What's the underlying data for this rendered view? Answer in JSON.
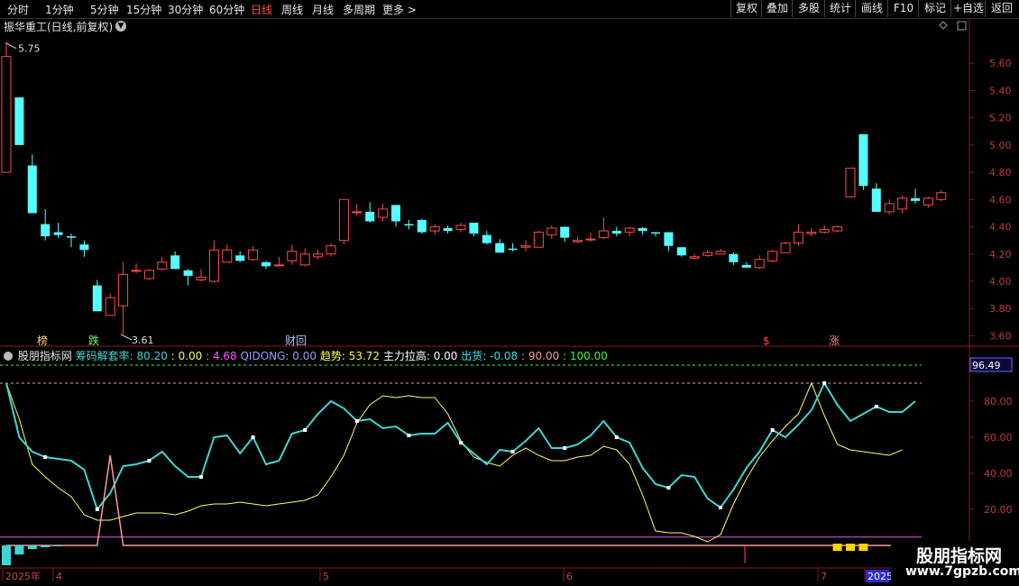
{
  "topbar": {
    "periods": [
      "分时",
      "1分钟",
      "5分钟",
      "15分钟",
      "30分钟",
      "60分钟",
      "日线",
      "周线",
      "月线",
      "多周期",
      "更多 >"
    ],
    "active_period": "日线",
    "buttons": [
      "复权",
      "叠加",
      "多股",
      "统计",
      "画线",
      "F10",
      "标记",
      "+自选",
      "返回"
    ]
  },
  "stock": {
    "title": "振华重工(日线,前复权)",
    "high_label": "5.75",
    "low_label": "3.61"
  },
  "price_axis": [
    "5.60",
    "5.40",
    "5.20",
    "5.00",
    "4.80",
    "4.60",
    "4.40",
    "4.20",
    "4.00",
    "3.80",
    "3.60"
  ],
  "event_markers": [
    {
      "text": "榜",
      "color": "#ffcc66"
    },
    {
      "text": "跌",
      "color": "#66ff66"
    },
    {
      "text": "财|回",
      "color": "#9fc3ff"
    },
    {
      "text": "$",
      "color": "#ff4444"
    },
    {
      "text": "涨",
      "color": "#ff7777"
    }
  ],
  "indicator": {
    "name": "股朋指标网",
    "items": [
      {
        "text": "筹码解套率: 80.20",
        "color": "#3fd6d6"
      },
      {
        "text": " : 0.00",
        "color": "#ffff66"
      },
      {
        "text": " : 4.68",
        "color": "#ff55ff"
      },
      {
        "text": " QIDONG: 0.00",
        "color": "#9a9aff"
      },
      {
        "text": " 趋势: 53.72",
        "color": "#ffff33"
      },
      {
        "text": " 主力拉高: 0.00",
        "color": "#ffffff"
      },
      {
        "text": " 出货: -0.08",
        "color": "#33e5e5"
      },
      {
        "text": " : 90.00",
        "color": "#ff9a9a"
      },
      {
        "text": " : 100.00",
        "color": "#33ff33"
      }
    ],
    "axis": [
      "80.00",
      "60.00",
      "40.00",
      "20.00"
    ],
    "current_value": "96.49"
  },
  "date_axis": [
    "2025年",
    "4",
    "5",
    "6",
    "7",
    "2025"
  ],
  "watermark": {
    "cn": "股朋指标网",
    "url": "www.7gpzb.com"
  },
  "chart_data": {
    "type": "candlestick",
    "title": "振华重工(日线,前复权)",
    "ylim": [
      3.55,
      5.8
    ],
    "candles": [
      {
        "o": 4.8,
        "c": 5.65,
        "h": 5.75,
        "l": 4.8
      },
      {
        "o": 5.35,
        "c": 5.0,
        "h": 5.35,
        "l": 5.0
      },
      {
        "o": 4.85,
        "c": 4.5,
        "h": 4.93,
        "l": 4.5
      },
      {
        "o": 4.42,
        "c": 4.33,
        "h": 4.53,
        "l": 4.3
      },
      {
        "o": 4.36,
        "c": 4.34,
        "h": 4.43,
        "l": 4.32
      },
      {
        "o": 4.33,
        "c": 4.32,
        "h": 4.35,
        "l": 4.25
      },
      {
        "o": 4.27,
        "c": 4.23,
        "h": 4.3,
        "l": 4.18
      },
      {
        "o": 3.97,
        "c": 3.78,
        "h": 4.01,
        "l": 3.78
      },
      {
        "o": 3.75,
        "c": 3.88,
        "h": 3.91,
        "l": 3.75
      },
      {
        "o": 3.82,
        "c": 4.05,
        "h": 4.14,
        "l": 3.61
      },
      {
        "o": 4.08,
        "c": 4.08,
        "h": 4.13,
        "l": 4.06
      },
      {
        "o": 4.02,
        "c": 4.08,
        "h": 4.09,
        "l": 4.01
      },
      {
        "o": 4.09,
        "c": 4.14,
        "h": 4.18,
        "l": 4.08
      },
      {
        "o": 4.19,
        "c": 4.09,
        "h": 4.22,
        "l": 4.09
      },
      {
        "o": 4.08,
        "c": 4.04,
        "h": 4.09,
        "l": 3.97
      },
      {
        "o": 4.01,
        "c": 4.03,
        "h": 4.09,
        "l": 4.0
      },
      {
        "o": 4.0,
        "c": 4.23,
        "h": 4.3,
        "l": 3.99
      },
      {
        "o": 4.14,
        "c": 4.23,
        "h": 4.27,
        "l": 4.14
      },
      {
        "o": 4.19,
        "c": 4.15,
        "h": 4.22,
        "l": 4.14
      },
      {
        "o": 4.16,
        "c": 4.23,
        "h": 4.26,
        "l": 4.15
      },
      {
        "o": 4.14,
        "c": 4.11,
        "h": 4.15,
        "l": 4.09
      },
      {
        "o": 4.12,
        "c": 4.12,
        "h": 4.18,
        "l": 4.11
      },
      {
        "o": 4.15,
        "c": 4.22,
        "h": 4.27,
        "l": 4.12
      },
      {
        "o": 4.12,
        "c": 4.2,
        "h": 4.24,
        "l": 4.11
      },
      {
        "o": 4.18,
        "c": 4.2,
        "h": 4.23,
        "l": 4.16
      },
      {
        "o": 4.2,
        "c": 4.26,
        "h": 4.28,
        "l": 4.18
      },
      {
        "o": 4.3,
        "c": 4.6,
        "h": 4.6,
        "l": 4.27
      },
      {
        "o": 4.51,
        "c": 4.51,
        "h": 4.57,
        "l": 4.48
      },
      {
        "o": 4.51,
        "c": 4.44,
        "h": 4.58,
        "l": 4.43
      },
      {
        "o": 4.47,
        "c": 4.53,
        "h": 4.57,
        "l": 4.44
      },
      {
        "o": 4.56,
        "c": 4.44,
        "h": 4.56,
        "l": 4.4
      },
      {
        "o": 4.42,
        "c": 4.41,
        "h": 4.45,
        "l": 4.38
      },
      {
        "o": 4.45,
        "c": 4.36,
        "h": 4.46,
        "l": 4.35
      },
      {
        "o": 4.37,
        "c": 4.4,
        "h": 4.42,
        "l": 4.34
      },
      {
        "o": 4.39,
        "c": 4.37,
        "h": 4.41,
        "l": 4.35
      },
      {
        "o": 4.38,
        "c": 4.41,
        "h": 4.43,
        "l": 4.36
      },
      {
        "o": 4.43,
        "c": 4.35,
        "h": 4.43,
        "l": 4.33
      },
      {
        "o": 4.34,
        "c": 4.28,
        "h": 4.37,
        "l": 4.27
      },
      {
        "o": 4.28,
        "c": 4.21,
        "h": 4.31,
        "l": 4.21
      },
      {
        "o": 4.24,
        "c": 4.23,
        "h": 4.28,
        "l": 4.22
      },
      {
        "o": 4.25,
        "c": 4.26,
        "h": 4.3,
        "l": 4.22
      },
      {
        "o": 4.25,
        "c": 4.36,
        "h": 4.37,
        "l": 4.25
      },
      {
        "o": 4.34,
        "c": 4.39,
        "h": 4.41,
        "l": 4.31
      },
      {
        "o": 4.4,
        "c": 4.32,
        "h": 4.4,
        "l": 4.29
      },
      {
        "o": 4.29,
        "c": 4.3,
        "h": 4.33,
        "l": 4.28
      },
      {
        "o": 4.31,
        "c": 4.31,
        "h": 4.36,
        "l": 4.29
      },
      {
        "o": 4.32,
        "c": 4.37,
        "h": 4.47,
        "l": 4.31
      },
      {
        "o": 4.37,
        "c": 4.35,
        "h": 4.4,
        "l": 4.33
      },
      {
        "o": 4.36,
        "c": 4.39,
        "h": 4.4,
        "l": 4.33
      },
      {
        "o": 4.39,
        "c": 4.37,
        "h": 4.4,
        "l": 4.34
      },
      {
        "o": 4.36,
        "c": 4.35,
        "h": 4.36,
        "l": 4.33
      },
      {
        "o": 4.36,
        "c": 4.26,
        "h": 4.36,
        "l": 4.22
      },
      {
        "o": 4.25,
        "c": 4.19,
        "h": 4.25,
        "l": 4.18
      },
      {
        "o": 4.17,
        "c": 4.18,
        "h": 4.2,
        "l": 4.16
      },
      {
        "o": 4.19,
        "c": 4.21,
        "h": 4.23,
        "l": 4.18
      },
      {
        "o": 4.2,
        "c": 4.22,
        "h": 4.24,
        "l": 4.2
      },
      {
        "o": 4.2,
        "c": 4.14,
        "h": 4.21,
        "l": 4.12
      },
      {
        "o": 4.12,
        "c": 4.1,
        "h": 4.14,
        "l": 4.1
      },
      {
        "o": 4.1,
        "c": 4.16,
        "h": 4.19,
        "l": 4.09
      },
      {
        "o": 4.15,
        "c": 4.22,
        "h": 4.23,
        "l": 4.14
      },
      {
        "o": 4.21,
        "c": 4.28,
        "h": 4.29,
        "l": 4.21
      },
      {
        "o": 4.28,
        "c": 4.36,
        "h": 4.42,
        "l": 4.26
      },
      {
        "o": 4.35,
        "c": 4.36,
        "h": 4.39,
        "l": 4.33
      },
      {
        "o": 4.36,
        "c": 4.38,
        "h": 4.41,
        "l": 4.35
      },
      {
        "o": 4.37,
        "c": 4.4,
        "h": 4.41,
        "l": 4.36
      },
      {
        "o": 4.62,
        "c": 4.83,
        "h": 4.83,
        "l": 4.62
      },
      {
        "o": 5.08,
        "c": 4.7,
        "h": 5.08,
        "l": 4.67
      },
      {
        "o": 4.68,
        "c": 4.51,
        "h": 4.72,
        "l": 4.51
      },
      {
        "o": 4.51,
        "c": 4.57,
        "h": 4.6,
        "l": 4.49
      },
      {
        "o": 4.53,
        "c": 4.61,
        "h": 4.63,
        "l": 4.5
      },
      {
        "o": 4.61,
        "c": 4.59,
        "h": 4.68,
        "l": 4.57
      },
      {
        "o": 4.56,
        "c": 4.61,
        "h": 4.62,
        "l": 4.54
      },
      {
        "o": 4.6,
        "c": 4.65,
        "h": 4.67,
        "l": 4.59
      }
    ],
    "indicator_ylim": [
      0,
      100
    ],
    "series": [
      {
        "name": "筹码解套率",
        "values": [
          90,
          60,
          52,
          49,
          48,
          47,
          42,
          20,
          29,
          44,
          45,
          47,
          52,
          44,
          38,
          38,
          60,
          61,
          51,
          60,
          45,
          47,
          62,
          64,
          73,
          80,
          76,
          69,
          70,
          65,
          66,
          61,
          62,
          62,
          68,
          57,
          51,
          45,
          53,
          52,
          58,
          65,
          54,
          54,
          56,
          61,
          69,
          60,
          57,
          43,
          34,
          32,
          39,
          38,
          26,
          21,
          31,
          43,
          52,
          64,
          60,
          67,
          75,
          90,
          78,
          69,
          73,
          77,
          74,
          74,
          80
        ]
      },
      {
        "name": "趋势",
        "values": [
          90,
          70,
          45,
          38,
          32,
          27,
          17,
          14,
          14,
          16,
          18,
          18,
          18,
          17,
          19,
          22,
          23,
          23,
          24,
          23,
          22,
          23,
          24,
          25,
          28,
          38,
          50,
          68,
          78,
          83,
          82,
          83,
          82,
          82,
          73,
          58,
          49,
          46,
          44,
          50,
          54,
          50,
          47,
          47,
          49,
          50,
          55,
          53,
          45,
          28,
          8,
          7,
          7,
          5,
          2,
          6,
          23,
          37,
          49,
          58,
          66,
          73,
          90,
          72,
          56,
          53,
          52,
          51,
          50,
          53
        ]
      },
      {
        "name": "主力拉高",
        "values": [
          0,
          0,
          0,
          0,
          0,
          0,
          0,
          0,
          50,
          0,
          0,
          0,
          0,
          0,
          0,
          0,
          0,
          0,
          0,
          0,
          0,
          0,
          0,
          0,
          0,
          0,
          0,
          0,
          0,
          0,
          0,
          0,
          0,
          0,
          0,
          0,
          0,
          0,
          0,
          0,
          0,
          0,
          0,
          0,
          0,
          0,
          0,
          0,
          0,
          0,
          0,
          0,
          0,
          0,
          0,
          0,
          0,
          0,
          0,
          0,
          0,
          0,
          0,
          0,
          0,
          0,
          0,
          0,
          0,
          0
        ]
      }
    ],
    "ref_lines": [
      {
        "name": "",
        "value": 90,
        "color": "#ff9a9a"
      },
      {
        "name": "",
        "value": 100,
        "color": "#33ff33"
      },
      {
        "name": "",
        "value": 4.68,
        "color": "#ff55ff"
      }
    ]
  }
}
